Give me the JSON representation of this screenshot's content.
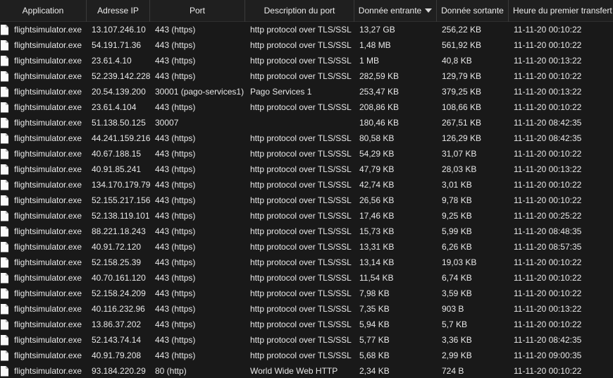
{
  "columns": {
    "application": "Application",
    "ip": "Adresse IP",
    "port": "Port",
    "description": "Description du port",
    "incoming": "Donnée entrante",
    "outgoing": "Donnée sortante",
    "time": "Heure du premier transfert"
  },
  "sort": {
    "column": "incoming",
    "direction": "descending",
    "icon": "sort-down-icon"
  },
  "colors": {
    "background": "#191919",
    "header": "#1f1f1f",
    "text": "#e8e8e8"
  },
  "rows": [
    {
      "app": "flightsimulator.exe",
      "ip": "13.107.246.10",
      "port": "443 (https)",
      "desc": "http protocol over TLS/SSL",
      "in": "13,27 GB",
      "out": "256,22 KB",
      "time": "11-11-20 00:10:22"
    },
    {
      "app": "flightsimulator.exe",
      "ip": "54.191.71.36",
      "port": "443 (https)",
      "desc": "http protocol over TLS/SSL",
      "in": "1,48 MB",
      "out": "561,92 KB",
      "time": "11-11-20 00:10:22"
    },
    {
      "app": "flightsimulator.exe",
      "ip": "23.61.4.10",
      "port": "443 (https)",
      "desc": "http protocol over TLS/SSL",
      "in": "1 MB",
      "out": "40,8 KB",
      "time": "11-11-20 00:13:22"
    },
    {
      "app": "flightsimulator.exe",
      "ip": "52.239.142.228",
      "port": "443 (https)",
      "desc": "http protocol over TLS/SSL",
      "in": "282,59 KB",
      "out": "129,79 KB",
      "time": "11-11-20 00:10:22"
    },
    {
      "app": "flightsimulator.exe",
      "ip": "20.54.139.200",
      "port": "30001 (pago-services1)",
      "desc": "Pago Services 1",
      "in": "253,47 KB",
      "out": "379,25 KB",
      "time": "11-11-20 00:13:22"
    },
    {
      "app": "flightsimulator.exe",
      "ip": "23.61.4.104",
      "port": "443 (https)",
      "desc": "http protocol over TLS/SSL",
      "in": "208,86 KB",
      "out": "108,66 KB",
      "time": "11-11-20 00:10:22"
    },
    {
      "app": "flightsimulator.exe",
      "ip": "51.138.50.125",
      "port": "30007",
      "desc": "",
      "in": "180,46 KB",
      "out": "267,51 KB",
      "time": "11-11-20 08:42:35"
    },
    {
      "app": "flightsimulator.exe",
      "ip": "44.241.159.216",
      "port": "443 (https)",
      "desc": "http protocol over TLS/SSL",
      "in": "80,58 KB",
      "out": "126,29 KB",
      "time": "11-11-20 08:42:35"
    },
    {
      "app": "flightsimulator.exe",
      "ip": "40.67.188.15",
      "port": "443 (https)",
      "desc": "http protocol over TLS/SSL",
      "in": "54,29 KB",
      "out": "31,07 KB",
      "time": "11-11-20 00:10:22"
    },
    {
      "app": "flightsimulator.exe",
      "ip": "40.91.85.241",
      "port": "443 (https)",
      "desc": "http protocol over TLS/SSL",
      "in": "47,79 KB",
      "out": "28,03 KB",
      "time": "11-11-20 00:13:22"
    },
    {
      "app": "flightsimulator.exe",
      "ip": "134.170.179.79",
      "port": "443 (https)",
      "desc": "http protocol over TLS/SSL",
      "in": "42,74 KB",
      "out": "3,01 KB",
      "time": "11-11-20 00:10:22"
    },
    {
      "app": "flightsimulator.exe",
      "ip": "52.155.217.156",
      "port": "443 (https)",
      "desc": "http protocol over TLS/SSL",
      "in": "26,56 KB",
      "out": "9,78 KB",
      "time": "11-11-20 00:10:22"
    },
    {
      "app": "flightsimulator.exe",
      "ip": "52.138.119.101",
      "port": "443 (https)",
      "desc": "http protocol over TLS/SSL",
      "in": "17,46 KB",
      "out": "9,25 KB",
      "time": "11-11-20 00:25:22"
    },
    {
      "app": "flightsimulator.exe",
      "ip": "88.221.18.243",
      "port": "443 (https)",
      "desc": "http protocol over TLS/SSL",
      "in": "15,73 KB",
      "out": "5,99 KB",
      "time": "11-11-20 08:48:35"
    },
    {
      "app": "flightsimulator.exe",
      "ip": "40.91.72.120",
      "port": "443 (https)",
      "desc": "http protocol over TLS/SSL",
      "in": "13,31 KB",
      "out": "6,26 KB",
      "time": "11-11-20 08:57:35"
    },
    {
      "app": "flightsimulator.exe",
      "ip": "52.158.25.39",
      "port": "443 (https)",
      "desc": "http protocol over TLS/SSL",
      "in": "13,14 KB",
      "out": "19,03 KB",
      "time": "11-11-20 00:10:22"
    },
    {
      "app": "flightsimulator.exe",
      "ip": "40.70.161.120",
      "port": "443 (https)",
      "desc": "http protocol over TLS/SSL",
      "in": "11,54 KB",
      "out": "6,74 KB",
      "time": "11-11-20 00:10:22"
    },
    {
      "app": "flightsimulator.exe",
      "ip": "52.158.24.209",
      "port": "443 (https)",
      "desc": "http protocol over TLS/SSL",
      "in": "7,98 KB",
      "out": "3,59 KB",
      "time": "11-11-20 00:10:22"
    },
    {
      "app": "flightsimulator.exe",
      "ip": "40.116.232.96",
      "port": "443 (https)",
      "desc": "http protocol over TLS/SSL",
      "in": "7,35 KB",
      "out": "903 B",
      "time": "11-11-20 00:13:22"
    },
    {
      "app": "flightsimulator.exe",
      "ip": "13.86.37.202",
      "port": "443 (https)",
      "desc": "http protocol over TLS/SSL",
      "in": "5,94 KB",
      "out": "5,7 KB",
      "time": "11-11-20 00:10:22"
    },
    {
      "app": "flightsimulator.exe",
      "ip": "52.143.74.14",
      "port": "443 (https)",
      "desc": "http protocol over TLS/SSL",
      "in": "5,77 KB",
      "out": "3,36 KB",
      "time": "11-11-20 08:42:35"
    },
    {
      "app": "flightsimulator.exe",
      "ip": "40.91.79.208",
      "port": "443 (https)",
      "desc": "http protocol over TLS/SSL",
      "in": "5,68 KB",
      "out": "2,99 KB",
      "time": "11-11-20 09:00:35"
    },
    {
      "app": "flightsimulator.exe",
      "ip": "93.184.220.29",
      "port": "80 (http)",
      "desc": "World Wide Web HTTP",
      "in": "2,34 KB",
      "out": "724 B",
      "time": "11-11-20 00:10:22"
    }
  ]
}
